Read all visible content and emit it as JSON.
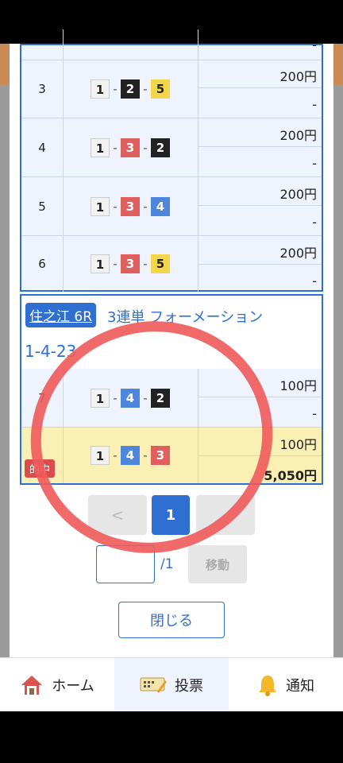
{
  "rows": [
    {
      "no": "",
      "combo": [
        "",
        "",
        ""
      ],
      "amount": "",
      "payout": "-"
    },
    {
      "no": "3",
      "combo": [
        "1",
        "2",
        "5"
      ],
      "amount": "200円",
      "payout": "-"
    },
    {
      "no": "4",
      "combo": [
        "1",
        "3",
        "2"
      ],
      "amount": "200円",
      "payout": "-"
    },
    {
      "no": "5",
      "combo": [
        "1",
        "3",
        "4"
      ],
      "amount": "200円",
      "payout": "-"
    },
    {
      "no": "6",
      "combo": [
        "1",
        "3",
        "5"
      ],
      "amount": "200円",
      "payout": "-"
    }
  ],
  "section2": {
    "venue": "住之江 6R",
    "bet_type": "3連単 フォーメーション",
    "combo_text": "1-4-23",
    "rows": [
      {
        "no": "7",
        "combo": [
          "1",
          "4",
          "2"
        ],
        "amount": "100円",
        "payout": "-"
      },
      {
        "no": "",
        "badge": "的中",
        "combo": [
          "1",
          "4",
          "3"
        ],
        "amount": "100円",
        "payout": "5,050円"
      }
    ]
  },
  "pagination": {
    "prev": "<",
    "current": "1",
    "next": "",
    "total_suffix": "/1",
    "page_input_value": "",
    "move_label": "移動"
  },
  "close_label": "閉じる",
  "nav": {
    "home": "ホーム",
    "vote": "投票",
    "notify": "通知"
  },
  "colors": {
    "accent": "#2f6fd1",
    "hit_bg": "#fbf0b4",
    "hit_badge": "#d94d4d"
  }
}
